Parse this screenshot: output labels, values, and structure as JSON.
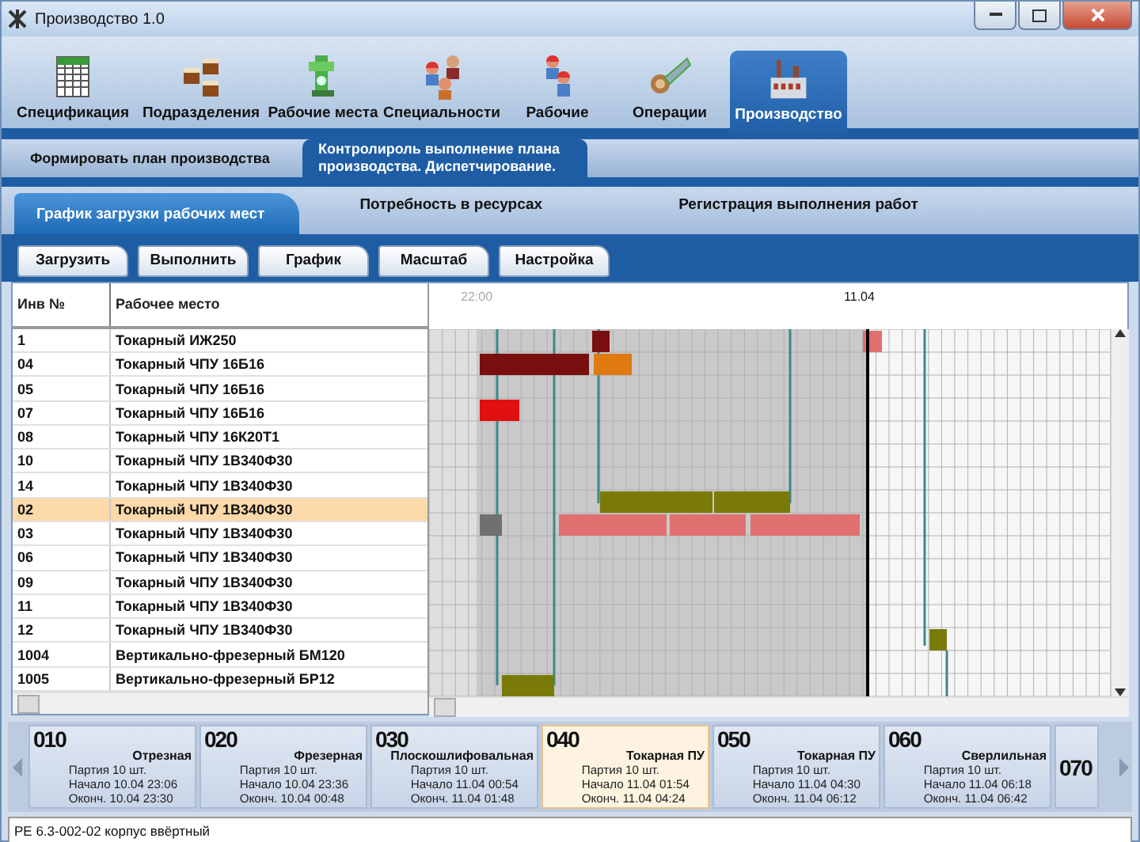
{
  "window": {
    "title": "Производство 1.0"
  },
  "modules": [
    {
      "label": "Спецификация",
      "selected": false
    },
    {
      "label": "Подразделения",
      "selected": false
    },
    {
      "label": "Рабочие места",
      "selected": false
    },
    {
      "label": "Специальности",
      "selected": false
    },
    {
      "label": "Рабочие",
      "selected": false
    },
    {
      "label": "Операции",
      "selected": false
    },
    {
      "label": "Производство",
      "selected": true
    }
  ],
  "plan_tabs": [
    {
      "label": "Формировать план производства",
      "selected": false
    },
    {
      "label": "Контролироль выполнение плана производства. Диспетчирование.",
      "selected": true
    }
  ],
  "view_tabs": [
    {
      "label": "График загрузки рабочих мест",
      "selected": true
    },
    {
      "label": "Потребность в ресурсах",
      "selected": false
    },
    {
      "label": "Регистрация выполнения работ",
      "selected": false
    }
  ],
  "toolbar_buttons": [
    "Загрузить",
    "Выполнить",
    "График",
    "Масштаб",
    "Настройка"
  ],
  "table": {
    "columns": [
      "Инв №",
      "Рабочее место"
    ],
    "rows": [
      {
        "cells": [
          "1",
          "Токарный ИЖ250"
        ],
        "selected": false
      },
      {
        "cells": [
          "04",
          "Токарный ЧПУ 16Б16"
        ],
        "selected": false
      },
      {
        "cells": [
          "05",
          "Токарный ЧПУ 16Б16"
        ],
        "selected": false
      },
      {
        "cells": [
          "07",
          "Токарный ЧПУ 16Б16"
        ],
        "selected": false
      },
      {
        "cells": [
          "08",
          "Токарный ЧПУ 16К20Т1"
        ],
        "selected": false
      },
      {
        "cells": [
          "10",
          "Токарный ЧПУ 1В340Ф30"
        ],
        "selected": false
      },
      {
        "cells": [
          "14",
          "Токарный ЧПУ 1В340Ф30"
        ],
        "selected": false
      },
      {
        "cells": [
          "02",
          "Токарный ЧПУ 1В340Ф30"
        ],
        "selected": true
      },
      {
        "cells": [
          "03",
          "Токарный ЧПУ 1В340Ф30"
        ],
        "selected": false
      },
      {
        "cells": [
          "06",
          "Токарный ЧПУ 1В340Ф30"
        ],
        "selected": false
      },
      {
        "cells": [
          "09",
          "Токарный ЧПУ 1В340Ф30"
        ],
        "selected": false
      },
      {
        "cells": [
          "11",
          "Токарный ЧПУ 1В340Ф30"
        ],
        "selected": false
      },
      {
        "cells": [
          "12",
          "Токарный ЧПУ 1В340Ф30"
        ],
        "selected": false
      },
      {
        "cells": [
          "1004",
          "Вертикально-фрезерный БМ120"
        ],
        "selected": false
      },
      {
        "cells": [
          "1005",
          "Вертикально-фрезерный БР12"
        ],
        "selected": false
      }
    ]
  },
  "timeline": {
    "labels": [
      "22:00",
      "11.04"
    ]
  },
  "operations": [
    {
      "number": "010",
      "name": "Отрезная",
      "batch": "Партия 10 шт.",
      "start": "Начало 10.04 23:06",
      "end": "Оконч. 10.04 23:30",
      "selected": false
    },
    {
      "number": "020",
      "name": "Фрезерная",
      "batch": "Партия 10 шт.",
      "start": "Начало 10.04 23:36",
      "end": "Оконч. 10.04 00:48",
      "selected": false
    },
    {
      "number": "030",
      "name": "Плоскошлифовальная",
      "batch": "Партия 10 шт.",
      "start": "Начало 11.04 00:54",
      "end": "Оконч. 11.04 01:48",
      "selected": false
    },
    {
      "number": "040",
      "name": "Токарная ПУ",
      "batch": "Партия 10 шт.",
      "start": "Начало 11.04 01:54",
      "end": "Оконч. 11.04 04:24",
      "selected": true
    },
    {
      "number": "050",
      "name": "Токарная ПУ",
      "batch": "Партия 10 шт.",
      "start": "Начало 11.04 04:30",
      "end": "Оконч. 11.04 06:12",
      "selected": false
    },
    {
      "number": "060",
      "name": "Сверлильная",
      "batch": "Партия 10 шт.",
      "start": "Начало 11.04 06:18",
      "end": "Оконч. 11.04 06:42",
      "selected": false
    },
    {
      "number": "070",
      "selected": false
    }
  ],
  "status_bar": "РЕ 6.3-002-02 корпус ввёртный"
}
